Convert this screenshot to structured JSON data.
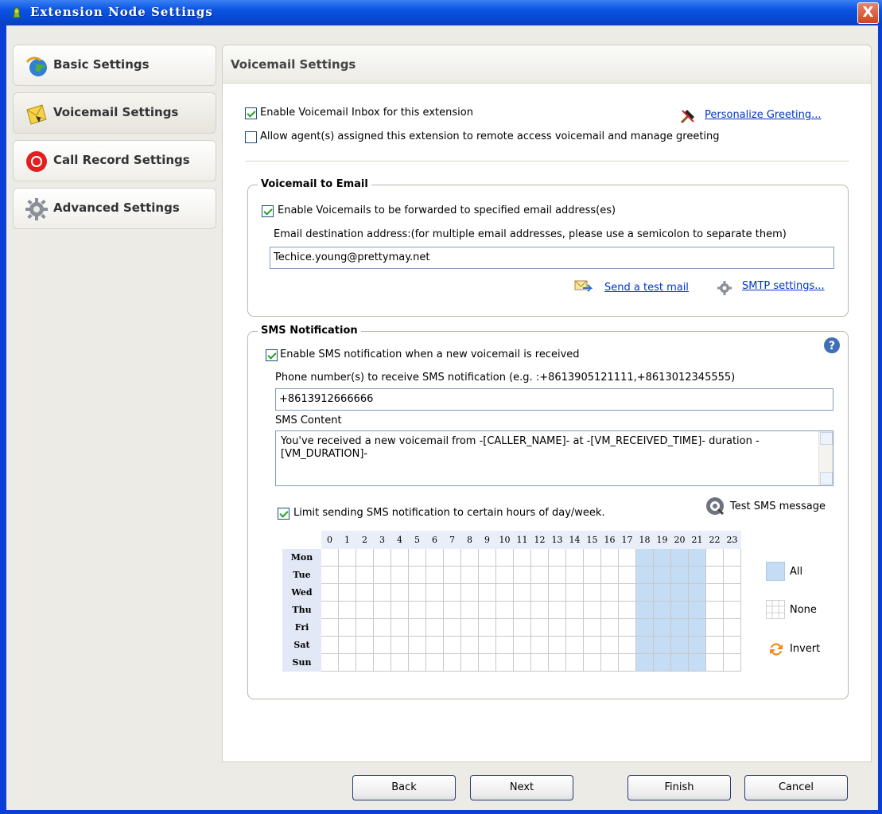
{
  "window": {
    "title": "Extension Node Settings",
    "close_label": "X"
  },
  "nav": {
    "items": [
      {
        "label": "Basic Settings",
        "icon": "globe-icon"
      },
      {
        "label": "Voicemail Settings",
        "icon": "voicemail-icon"
      },
      {
        "label": "Call Record Settings",
        "icon": "record-icon"
      },
      {
        "label": "Advanced Settings",
        "icon": "gear-icon"
      }
    ]
  },
  "panel": {
    "title": "Voicemail Settings",
    "enable_inbox": {
      "label": "Enable Voicemail Inbox for this extension",
      "checked": true
    },
    "remote_access": {
      "label": "Allow agent(s) assigned this extension to remote access voicemail and manage greeting",
      "checked": false
    },
    "personalize_link": "Personalize Greeting..."
  },
  "email_group": {
    "title": "Voicemail to Email",
    "enable": {
      "label": "Enable Voicemails to be forwarded to specified email address(es)",
      "checked": true
    },
    "dest_label": "Email destination address:(for multiple email addresses, please use a semicolon to separate them)",
    "dest_value": "Techice.young@prettymay.net",
    "test_mail_link": "Send a test mail",
    "smtp_link": "SMTP settings..."
  },
  "sms_group": {
    "title": "SMS Notification",
    "enable": {
      "label": "Enable SMS notification when a new voicemail is received",
      "checked": true
    },
    "phone_label": "Phone number(s) to receive SMS notification (e.g. :+8613905121111,+8613012345555)",
    "phone_value": "+8613912666666",
    "content_label": "SMS Content",
    "content_value": "You've received a new voicemail from -[CALLER_NAME]- at -[VM_RECEIVED_TIME]- duration -[VM_DURATION]-",
    "limit": {
      "label": "Limit sending SMS notification to certain hours of day/week.",
      "checked": true
    },
    "test_sms": "Test SMS message",
    "hours": [
      "0",
      "1",
      "2",
      "3",
      "4",
      "5",
      "6",
      "7",
      "8",
      "9",
      "10",
      "11",
      "12",
      "13",
      "14",
      "15",
      "16",
      "17",
      "18",
      "19",
      "20",
      "21",
      "22",
      "23"
    ],
    "days": [
      "Mon",
      "Tue",
      "Wed",
      "Thu",
      "Fri",
      "Sat",
      "Sun"
    ],
    "selected_hours": [
      18,
      19,
      20,
      21
    ],
    "all_label": "All",
    "none_label": "None",
    "invert_label": "Invert",
    "selected_color": "#c4dcf4"
  },
  "footer": {
    "back": "Back",
    "next": "Next",
    "finish": "Finish",
    "cancel": "Cancel"
  }
}
